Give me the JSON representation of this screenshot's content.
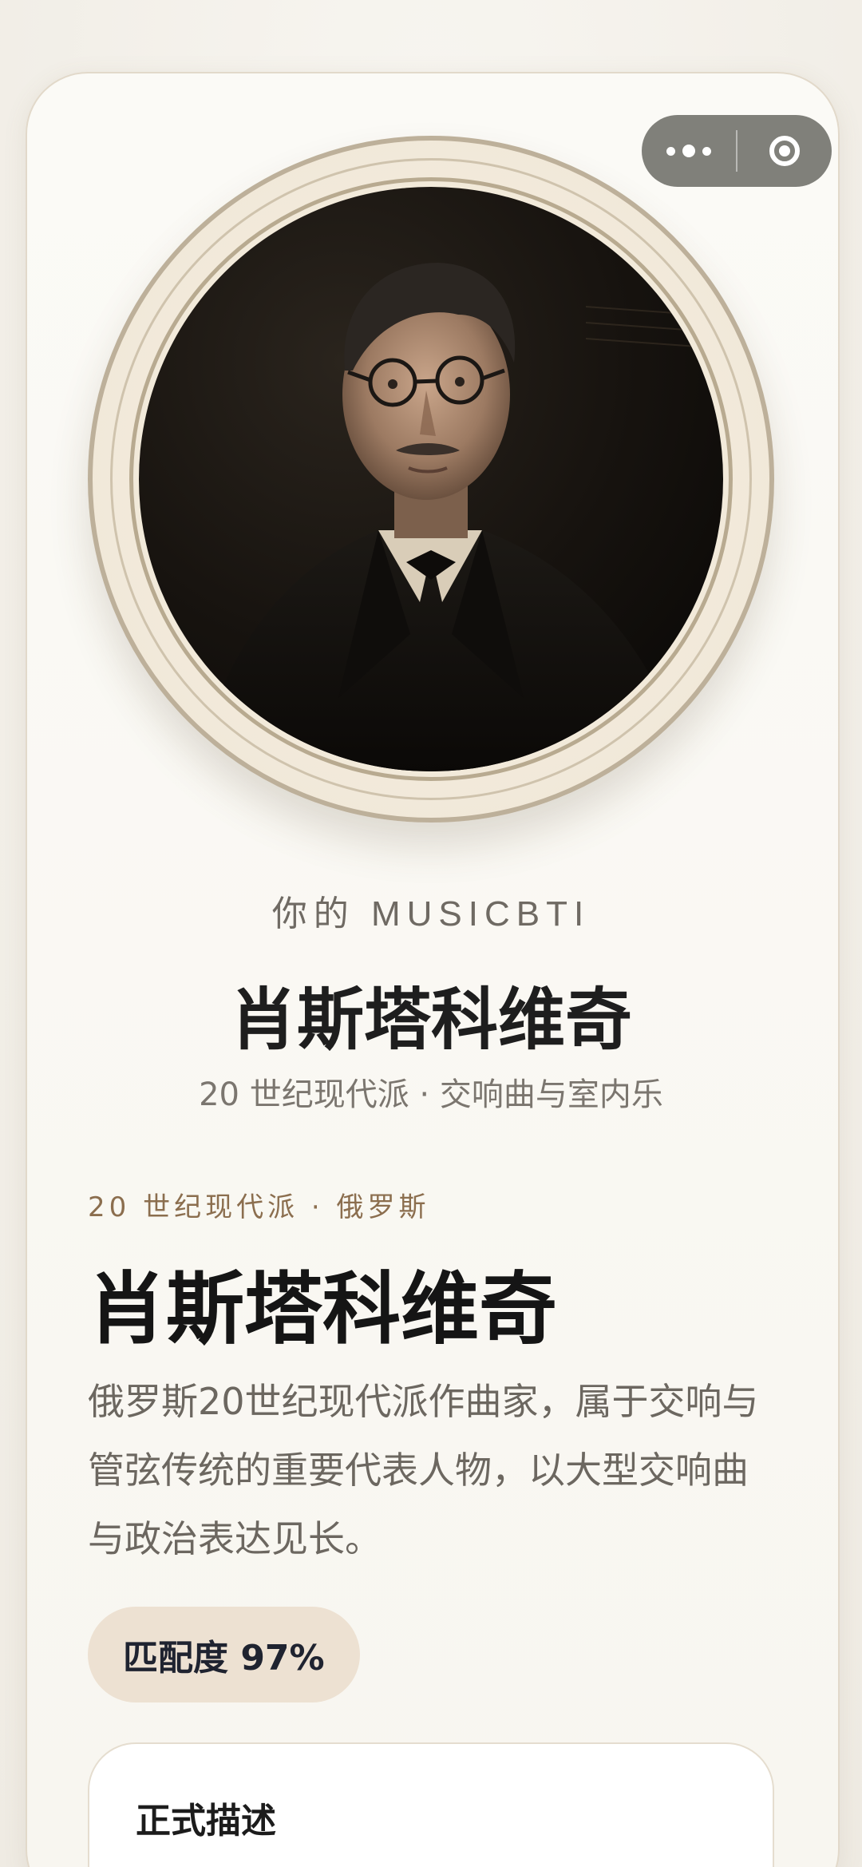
{
  "eyebrow": "你的 MUSICBTI",
  "result": {
    "name": "肖斯塔科维奇",
    "subtitle": "20 世纪现代派 · 交响曲与室内乐"
  },
  "detail": {
    "kicker": "20 世纪现代派 · 俄罗斯",
    "name": "肖斯塔科维奇",
    "description": "俄罗斯20世纪现代派作曲家，属于交响与管弦传统的重要代表人物，以大型交响曲与政治表达见长。",
    "match": "匹配度 97%"
  },
  "panel": {
    "title": "正式描述"
  },
  "capsule": {
    "more_icon": "more-dots-icon",
    "close_icon": "target-close-icon"
  },
  "colors": {
    "accent": "#8b6e4e",
    "match_bg": "#ede1d2",
    "frame": "#bdb09a"
  }
}
